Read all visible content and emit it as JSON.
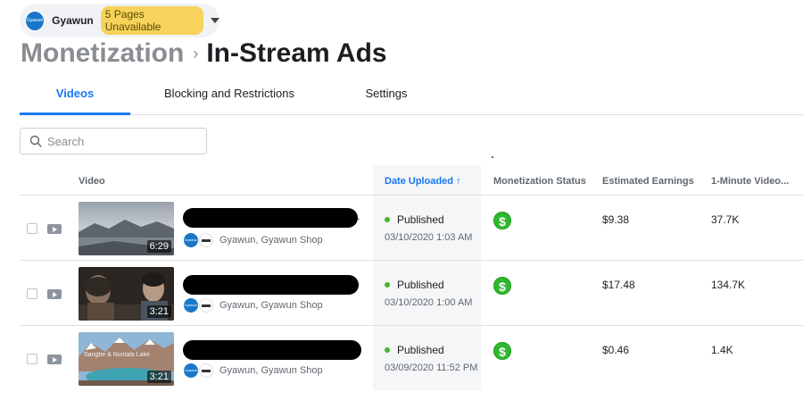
{
  "page_selector": {
    "avatar_text": "Gyawun",
    "page_name": "Gyawun",
    "badge": "5 Pages Unavailable"
  },
  "breadcrumb": {
    "parent": "Monetization",
    "separator": "›",
    "current": "In-Stream Ads"
  },
  "tabs": [
    {
      "label": "Videos",
      "active": true
    },
    {
      "label": "Blocking and Restrictions",
      "active": false
    },
    {
      "label": "Settings",
      "active": false
    }
  ],
  "search": {
    "placeholder": "Search"
  },
  "table": {
    "columns": {
      "video": "Video",
      "date_uploaded": "Date Uploaded ↑",
      "monetization_status": "Monetization Status",
      "estimated_earnings": "Estimated Earnings",
      "one_minute_views": "1-Minute Video..."
    },
    "rows": [
      {
        "duration": "6:29",
        "thumb_text": "",
        "title_suffix": ".",
        "owner": "Gyawun, Gyawun Shop",
        "status": "Published",
        "date": "03/10/2020 1:03 AM",
        "monetization_icon": "dollar-icon",
        "earnings": "$9.38",
        "views": "37.7K"
      },
      {
        "duration": "3:21",
        "thumb_text": "",
        "title_suffix": "",
        "owner": "Gyawun, Gyawun Shop",
        "status": "Published",
        "date": "03/10/2020 1:00 AM",
        "monetization_icon": "dollar-icon",
        "earnings": "$17.48",
        "views": "134.7K"
      },
      {
        "duration": "3:21",
        "thumb_text": "Sangbe & Nuntala Lake",
        "title_suffix": "",
        "owner": "Gyawun, Gyawun Shop",
        "status": "Published",
        "date": "03/09/2020 11:52 PM",
        "monetization_icon": "dollar-icon",
        "earnings": "$0.46",
        "views": "1.4K"
      }
    ]
  },
  "colors": {
    "accent": "#1877f2",
    "badge_bg": "#f7d35c",
    "published_dot": "#42b72a",
    "monetized_icon": "#2eb82e"
  }
}
